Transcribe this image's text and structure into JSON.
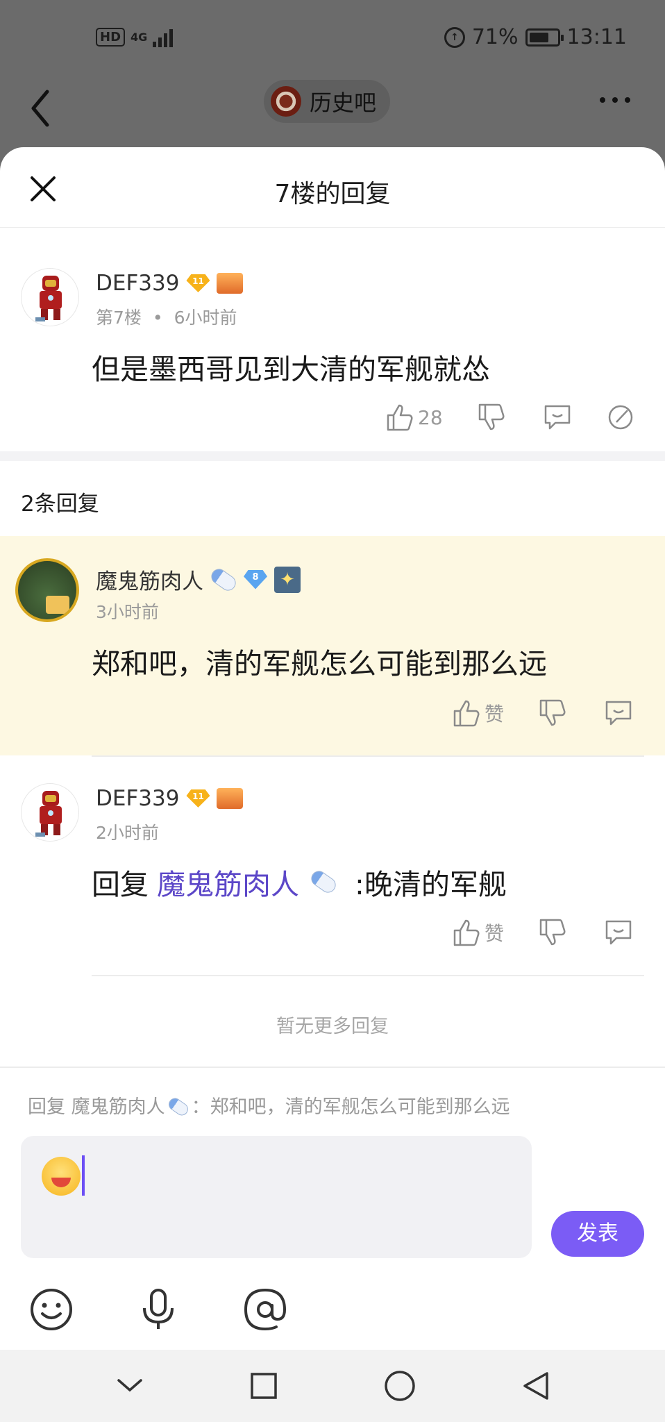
{
  "status_bar": {
    "network": "HD",
    "signal": "4G",
    "battery": "71%",
    "time": "13:11",
    "battery_level": 0.71
  },
  "header": {
    "forum_name": "历史吧"
  },
  "sheet": {
    "title": "7楼的回复"
  },
  "post": {
    "username": "DEF339",
    "level": "11",
    "floor": "第7楼",
    "separator": "•",
    "time": "6小时前",
    "content": "但是墨西哥见到大清的军舰就怂",
    "like_count": "28"
  },
  "replies": {
    "count_label": "2条回复",
    "items": [
      {
        "username": "魔鬼筋肉人",
        "level": "8",
        "time": "3小时前",
        "content": "郑和吧，清的军舰怎么可能到那么远",
        "like_label": "赞"
      },
      {
        "username": "DEF339",
        "level": "11",
        "time": "2小时前",
        "reply_prefix": "回复",
        "reply_to": "魔鬼筋肉人",
        "content": ":晚清的军舰",
        "like_label": "赞"
      }
    ],
    "no_more": "暂无更多回复"
  },
  "composer": {
    "quote_prefix": "回复 魔鬼筋肉人",
    "quote_text": "：郑和吧，清的军舰怎么可能到那么远",
    "send_label": "发表"
  },
  "colors": {
    "accent": "#7b5cf5",
    "link": "#5c47c8",
    "highlight_bg": "#fdf8e2"
  }
}
